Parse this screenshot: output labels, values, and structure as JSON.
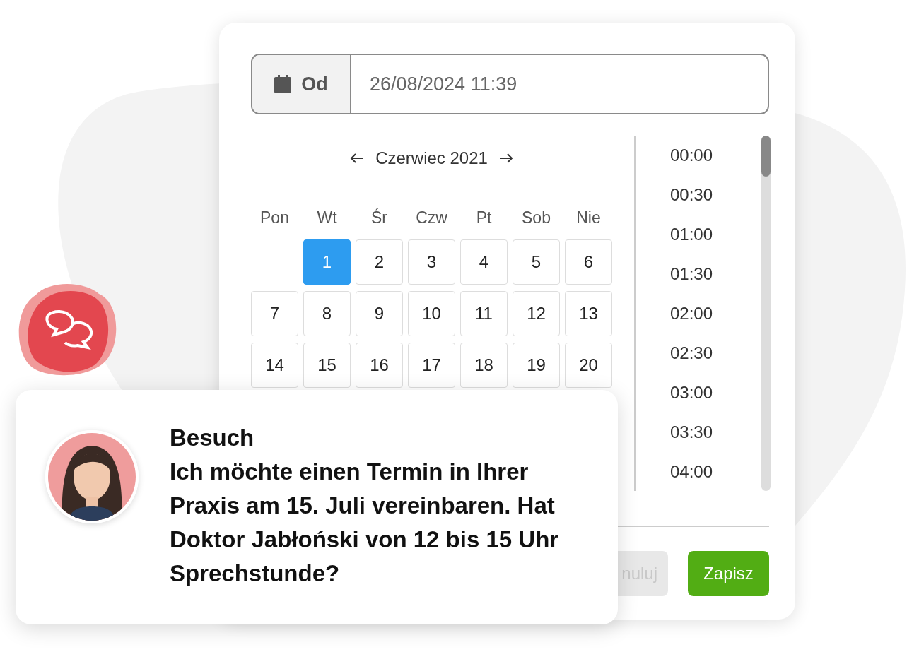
{
  "date_field": {
    "label": "Od",
    "value": "26/08/2024 11:39"
  },
  "calendar": {
    "month": "Czerwiec 2021",
    "weekdays": [
      "Pon",
      "Wt",
      "Śr",
      "Czw",
      "Pt",
      "Sob",
      "Nie"
    ],
    "weeks": [
      [
        {
          "kind": "blank"
        },
        {
          "kind": "day",
          "day": "1",
          "selected": true
        },
        {
          "kind": "day",
          "day": "2",
          "selected": false
        },
        {
          "kind": "day",
          "day": "3",
          "selected": false
        },
        {
          "kind": "day",
          "day": "4",
          "selected": false
        },
        {
          "kind": "day",
          "day": "5",
          "selected": false
        },
        {
          "kind": "day",
          "day": "6",
          "selected": false
        }
      ],
      [
        {
          "kind": "day",
          "day": "7",
          "selected": false
        },
        {
          "kind": "day",
          "day": "8",
          "selected": false
        },
        {
          "kind": "day",
          "day": "9",
          "selected": false
        },
        {
          "kind": "day",
          "day": "10",
          "selected": false
        },
        {
          "kind": "day",
          "day": "11",
          "selected": false
        },
        {
          "kind": "day",
          "day": "12",
          "selected": false
        },
        {
          "kind": "day",
          "day": "13",
          "selected": false
        }
      ],
      [
        {
          "kind": "day",
          "day": "14",
          "selected": false
        },
        {
          "kind": "day",
          "day": "15",
          "selected": false
        },
        {
          "kind": "day",
          "day": "16",
          "selected": false
        },
        {
          "kind": "day",
          "day": "17",
          "selected": false
        },
        {
          "kind": "day",
          "day": "18",
          "selected": false
        },
        {
          "kind": "day",
          "day": "19",
          "selected": false
        },
        {
          "kind": "day",
          "day": "20",
          "selected": false
        }
      ]
    ]
  },
  "times": [
    "00:00",
    "00:30",
    "01:00",
    "01:30",
    "02:00",
    "02:30",
    "03:00",
    "03:30",
    "04:00"
  ],
  "buttons": [
    {
      "label": "nuluj",
      "kind": "secondary"
    },
    {
      "label": "Zapisz",
      "kind": "primary"
    }
  ],
  "chat": {
    "title": "Besuch",
    "message": "Ich möchte einen Termin in Ihrer Praxis am 15. Juli vereinbaren. Hat Doktor Jabłoński von 12 bis 15 Uhr Sprechstunde?"
  }
}
